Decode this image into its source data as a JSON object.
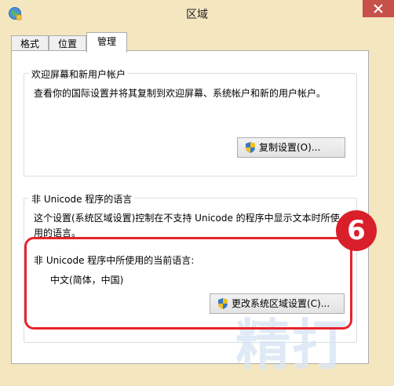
{
  "window": {
    "title": "区域"
  },
  "tabs": [
    {
      "label": "格式"
    },
    {
      "label": "位置"
    },
    {
      "label": "管理"
    }
  ],
  "welcome_group": {
    "title": "欢迎屏幕和新用户帐户",
    "description": "查看你的国际设置并将其复制到欢迎屏幕、系统帐户和新的用户帐户。",
    "copy_button": "复制设置(O)..."
  },
  "nonunicode_group": {
    "title": "非 Unicode 程序的语言",
    "description_line1": "这个设置(系统区域设置)控制在不支持 Unicode 的程序中显示文本时所使",
    "description_line2": "用的语言。",
    "current_label": "非 Unicode 程序中所使用的当前语言:",
    "current_value": "中文(简体，中国)",
    "change_button": "更改系统区域设置(C)..."
  },
  "annotation": {
    "step_number": "6",
    "watermark": "精打"
  },
  "colors": {
    "highlight": "#e8242b",
    "badge": "#d91f2a",
    "close": "#c7504a"
  }
}
